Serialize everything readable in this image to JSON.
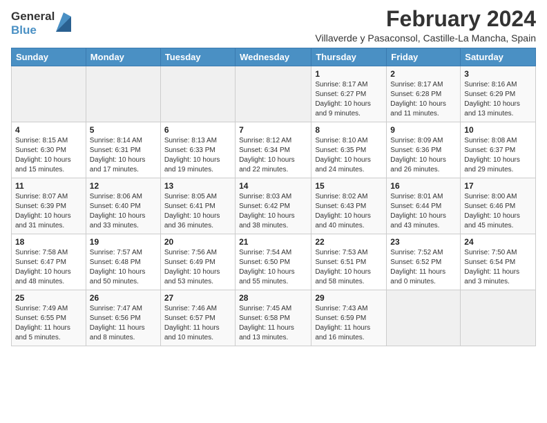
{
  "header": {
    "logo_general": "General",
    "logo_blue": "Blue",
    "main_title": "February 2024",
    "subtitle": "Villaverde y Pasaconsol, Castille-La Mancha, Spain"
  },
  "days_of_week": [
    "Sunday",
    "Monday",
    "Tuesday",
    "Wednesday",
    "Thursday",
    "Friday",
    "Saturday"
  ],
  "weeks": [
    [
      {
        "day": "",
        "info": ""
      },
      {
        "day": "",
        "info": ""
      },
      {
        "day": "",
        "info": ""
      },
      {
        "day": "",
        "info": ""
      },
      {
        "day": "1",
        "info": "Sunrise: 8:17 AM\nSunset: 6:27 PM\nDaylight: 10 hours and 9 minutes."
      },
      {
        "day": "2",
        "info": "Sunrise: 8:17 AM\nSunset: 6:28 PM\nDaylight: 10 hours and 11 minutes."
      },
      {
        "day": "3",
        "info": "Sunrise: 8:16 AM\nSunset: 6:29 PM\nDaylight: 10 hours and 13 minutes."
      }
    ],
    [
      {
        "day": "4",
        "info": "Sunrise: 8:15 AM\nSunset: 6:30 PM\nDaylight: 10 hours and 15 minutes."
      },
      {
        "day": "5",
        "info": "Sunrise: 8:14 AM\nSunset: 6:31 PM\nDaylight: 10 hours and 17 minutes."
      },
      {
        "day": "6",
        "info": "Sunrise: 8:13 AM\nSunset: 6:33 PM\nDaylight: 10 hours and 19 minutes."
      },
      {
        "day": "7",
        "info": "Sunrise: 8:12 AM\nSunset: 6:34 PM\nDaylight: 10 hours and 22 minutes."
      },
      {
        "day": "8",
        "info": "Sunrise: 8:10 AM\nSunset: 6:35 PM\nDaylight: 10 hours and 24 minutes."
      },
      {
        "day": "9",
        "info": "Sunrise: 8:09 AM\nSunset: 6:36 PM\nDaylight: 10 hours and 26 minutes."
      },
      {
        "day": "10",
        "info": "Sunrise: 8:08 AM\nSunset: 6:37 PM\nDaylight: 10 hours and 29 minutes."
      }
    ],
    [
      {
        "day": "11",
        "info": "Sunrise: 8:07 AM\nSunset: 6:39 PM\nDaylight: 10 hours and 31 minutes."
      },
      {
        "day": "12",
        "info": "Sunrise: 8:06 AM\nSunset: 6:40 PM\nDaylight: 10 hours and 33 minutes."
      },
      {
        "day": "13",
        "info": "Sunrise: 8:05 AM\nSunset: 6:41 PM\nDaylight: 10 hours and 36 minutes."
      },
      {
        "day": "14",
        "info": "Sunrise: 8:03 AM\nSunset: 6:42 PM\nDaylight: 10 hours and 38 minutes."
      },
      {
        "day": "15",
        "info": "Sunrise: 8:02 AM\nSunset: 6:43 PM\nDaylight: 10 hours and 40 minutes."
      },
      {
        "day": "16",
        "info": "Sunrise: 8:01 AM\nSunset: 6:44 PM\nDaylight: 10 hours and 43 minutes."
      },
      {
        "day": "17",
        "info": "Sunrise: 8:00 AM\nSunset: 6:46 PM\nDaylight: 10 hours and 45 minutes."
      }
    ],
    [
      {
        "day": "18",
        "info": "Sunrise: 7:58 AM\nSunset: 6:47 PM\nDaylight: 10 hours and 48 minutes."
      },
      {
        "day": "19",
        "info": "Sunrise: 7:57 AM\nSunset: 6:48 PM\nDaylight: 10 hours and 50 minutes."
      },
      {
        "day": "20",
        "info": "Sunrise: 7:56 AM\nSunset: 6:49 PM\nDaylight: 10 hours and 53 minutes."
      },
      {
        "day": "21",
        "info": "Sunrise: 7:54 AM\nSunset: 6:50 PM\nDaylight: 10 hours and 55 minutes."
      },
      {
        "day": "22",
        "info": "Sunrise: 7:53 AM\nSunset: 6:51 PM\nDaylight: 10 hours and 58 minutes."
      },
      {
        "day": "23",
        "info": "Sunrise: 7:52 AM\nSunset: 6:52 PM\nDaylight: 11 hours and 0 minutes."
      },
      {
        "day": "24",
        "info": "Sunrise: 7:50 AM\nSunset: 6:54 PM\nDaylight: 11 hours and 3 minutes."
      }
    ],
    [
      {
        "day": "25",
        "info": "Sunrise: 7:49 AM\nSunset: 6:55 PM\nDaylight: 11 hours and 5 minutes."
      },
      {
        "day": "26",
        "info": "Sunrise: 7:47 AM\nSunset: 6:56 PM\nDaylight: 11 hours and 8 minutes."
      },
      {
        "day": "27",
        "info": "Sunrise: 7:46 AM\nSunset: 6:57 PM\nDaylight: 11 hours and 10 minutes."
      },
      {
        "day": "28",
        "info": "Sunrise: 7:45 AM\nSunset: 6:58 PM\nDaylight: 11 hours and 13 minutes."
      },
      {
        "day": "29",
        "info": "Sunrise: 7:43 AM\nSunset: 6:59 PM\nDaylight: 11 hours and 16 minutes."
      },
      {
        "day": "",
        "info": ""
      },
      {
        "day": "",
        "info": ""
      }
    ]
  ]
}
